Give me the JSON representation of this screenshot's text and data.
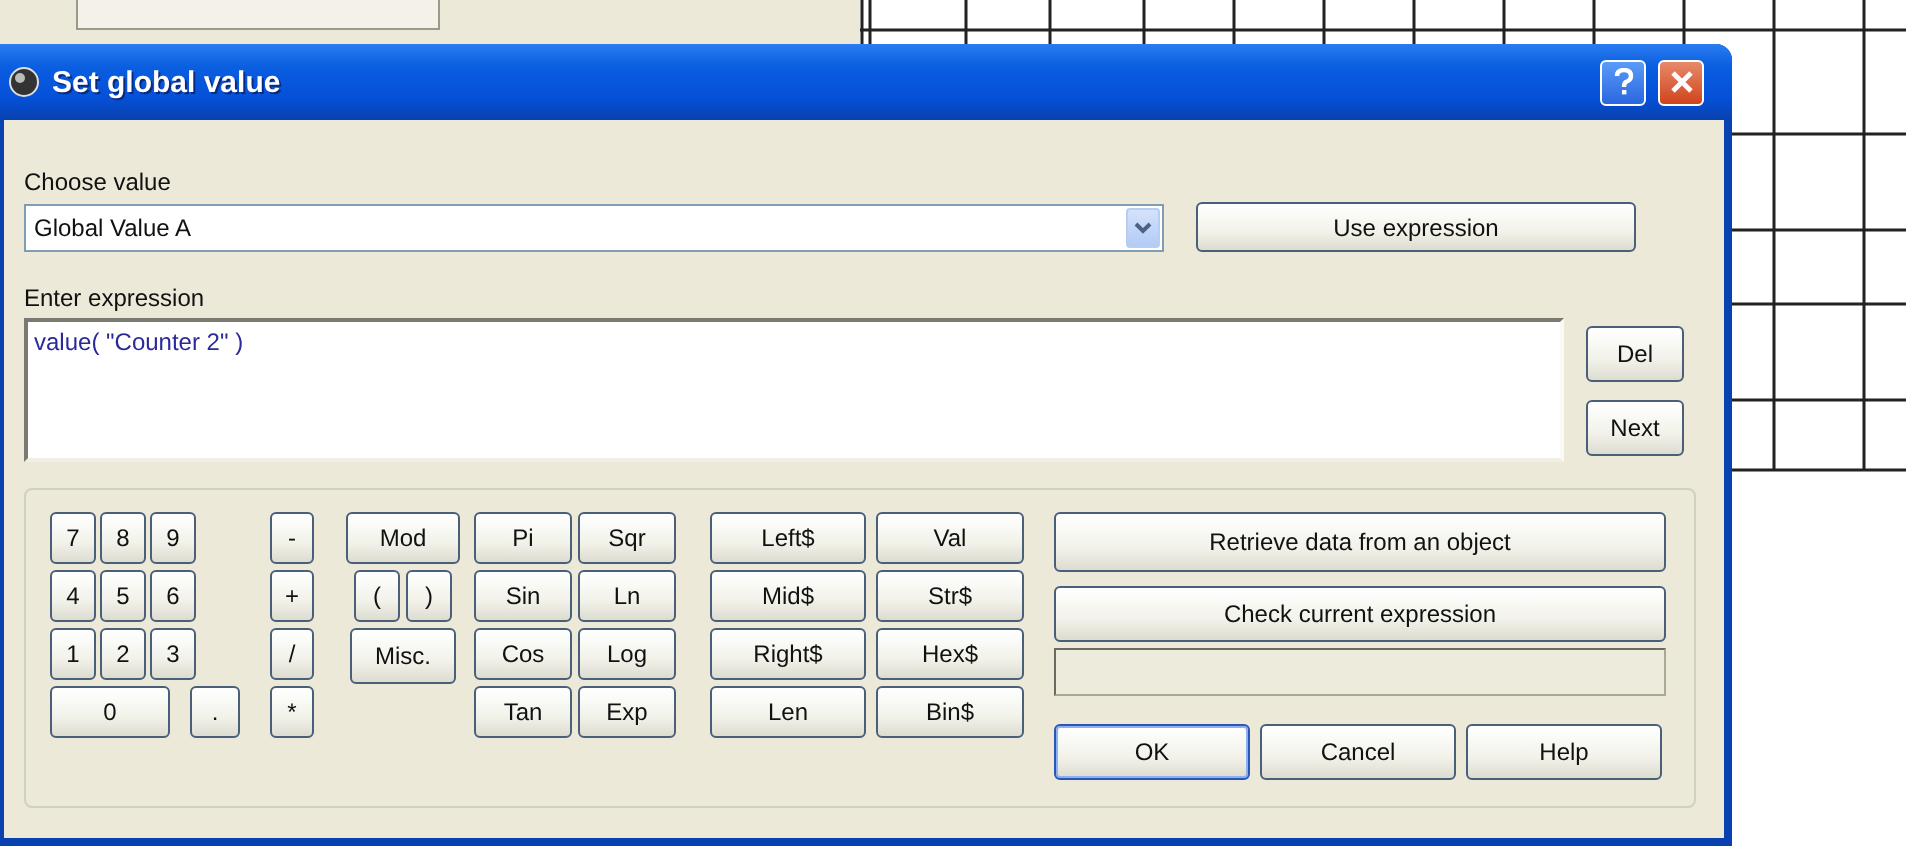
{
  "window": {
    "title": "Set global value"
  },
  "choose_value": {
    "label": "Choose value",
    "value": "Global Value A"
  },
  "use_expression_button": "Use expression",
  "expression": {
    "label": "Enter expression",
    "value": "value( \"Counter 2\" )"
  },
  "expression_buttons": [
    "Del",
    "Next"
  ],
  "keypad": {
    "digits": [
      [
        "7",
        "8",
        "9"
      ],
      [
        "4",
        "5",
        "6"
      ],
      [
        "1",
        "2",
        "3"
      ],
      [
        "0",
        "."
      ]
    ],
    "operators": [
      "-",
      "+",
      "/",
      "*"
    ],
    "special": [
      [
        "Mod"
      ],
      [
        "(",
        ")"
      ],
      [
        "Misc."
      ]
    ],
    "math": [
      [
        "Pi",
        "Sqr"
      ],
      [
        "Sin",
        "Ln"
      ],
      [
        "Cos",
        "Log"
      ],
      [
        "Tan",
        "Exp"
      ]
    ],
    "strings": [
      [
        "Left$",
        "Val"
      ],
      [
        "Mid$",
        "Str$"
      ],
      [
        "Right$",
        "Hex$"
      ],
      [
        "Len",
        "Bin$"
      ]
    ]
  },
  "actions": [
    "Retrieve data from an object",
    "Check current expression"
  ],
  "buttons": [
    {
      "label": "OK",
      "default": true
    },
    {
      "label": "Cancel",
      "default": false
    },
    {
      "label": "Help",
      "default": false
    }
  ]
}
